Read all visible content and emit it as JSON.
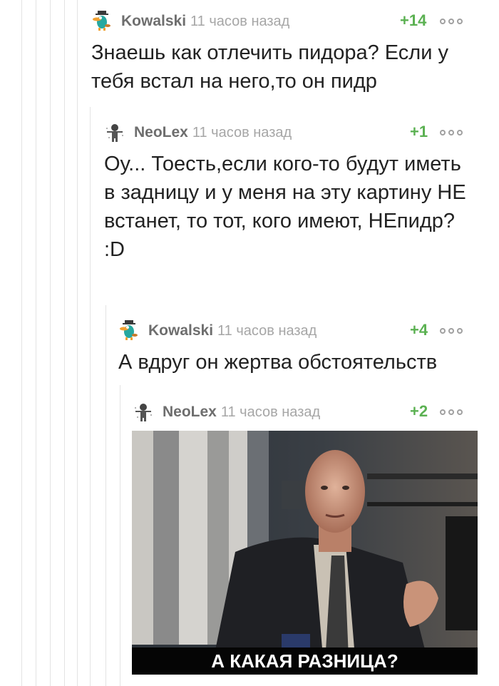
{
  "comments": [
    {
      "author": "Kowalski",
      "time": "11 часов назад",
      "rating": "+14",
      "text": "Знаешь как отлечить пидора? Если у тебя встал на него,то он пидр",
      "avatar": "platypus-avatar"
    },
    {
      "author": "NeoLex",
      "time": "11 часов назад",
      "rating": "+1",
      "text": "Оу... Тоесть,если кого-то будут иметь в задницу и у меня на эту картину НЕ встанет, то тот, кого имеют, НЕпидр? :D",
      "avatar": "neo-avatar"
    },
    {
      "author": "Kowalski",
      "time": "11 часов назад",
      "rating": "+4",
      "text": "А вдруг он жертва обстоятельств",
      "avatar": "platypus-avatar"
    },
    {
      "author": "NeoLex",
      "time": "11 часов назад",
      "rating": "+2",
      "avatar": "neo-avatar",
      "image_caption": "А КАКАЯ РАЗНИЦА?"
    }
  ],
  "colors": {
    "rating": "#5bb152",
    "author": "#6e6e6e",
    "time": "#a6a6a6",
    "text": "#222222",
    "thread_line": "#e3e3e3"
  }
}
